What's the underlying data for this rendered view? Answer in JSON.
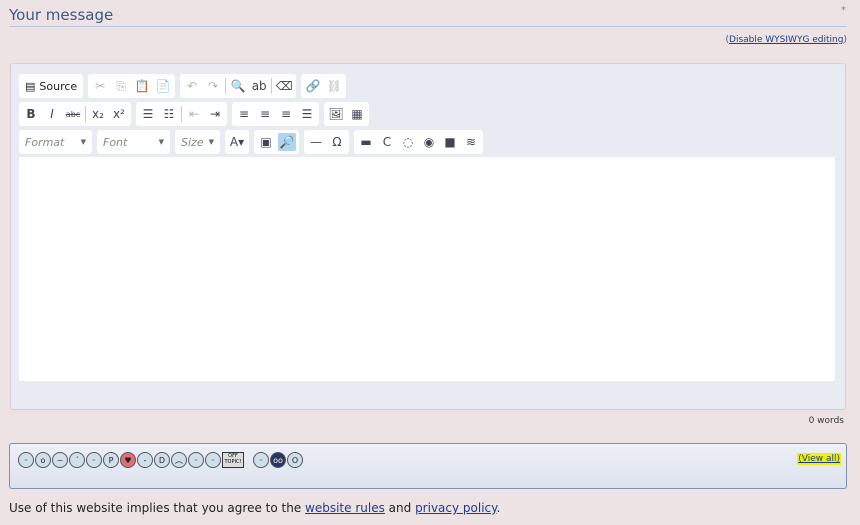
{
  "header": {
    "title": "Your message",
    "required_mark": "*",
    "disable_wysiwyg": "Disable WYSIWYG editing",
    "paren_open": "(",
    "paren_close": ")"
  },
  "toolbar": {
    "source_label": "Source",
    "row1": [
      [
        "cut-icon",
        "✂",
        true
      ],
      [
        "copy-icon",
        "⎘",
        true
      ],
      [
        "paste-icon",
        "📋",
        false
      ],
      [
        "paste-word-icon",
        "📄",
        false
      ],
      null,
      [
        "undo-icon",
        "↶",
        true
      ],
      [
        "redo-icon",
        "↷",
        true
      ],
      "|",
      [
        "find-icon",
        "🔍",
        false
      ],
      [
        "replace-icon",
        "ab",
        false
      ],
      "|",
      [
        "remove-format-icon",
        "⌫",
        false
      ],
      null,
      [
        "link-icon",
        "🔗",
        false
      ],
      [
        "unlink-icon",
        "⛓",
        true
      ]
    ],
    "row2": [
      [
        "bold-icon",
        "B",
        false
      ],
      [
        "italic-icon",
        "I",
        false
      ],
      [
        "strike-icon",
        "abc",
        false
      ],
      "|",
      [
        "subscript-icon",
        "x₂",
        false
      ],
      [
        "superscript-icon",
        "x²",
        false
      ],
      null,
      [
        "numbered-list-icon",
        "☰",
        false
      ],
      [
        "bulleted-list-icon",
        "☷",
        false
      ],
      "|",
      [
        "outdent-icon",
        "⇤",
        true
      ],
      [
        "indent-icon",
        "⇥",
        false
      ],
      null,
      [
        "align-left-icon",
        "≡",
        false
      ],
      [
        "align-center-icon",
        "≡",
        false
      ],
      [
        "align-right-icon",
        "≡",
        false
      ],
      [
        "justify-icon",
        "☰",
        false
      ],
      null,
      [
        "image-icon",
        "🖼",
        false
      ],
      [
        "table-icon",
        "▦",
        false
      ]
    ],
    "format": "Format",
    "font": "Font",
    "size": "Size",
    "row3": [
      [
        "text-color-icon",
        "A▾",
        false
      ],
      null,
      [
        "maximize-icon",
        "▣",
        false
      ],
      [
        "show-blocks-icon",
        "🔎",
        false
      ],
      null,
      [
        "horizontal-rule-icon",
        "—",
        false
      ],
      [
        "special-char-icon",
        "Ω",
        false
      ],
      null,
      [
        "quote-icon",
        "▬",
        false
      ],
      [
        "code-icon",
        "C",
        false
      ],
      [
        "spoiler-icon",
        "◌",
        false
      ],
      [
        "emoticon-icon",
        "◉",
        false
      ],
      [
        "highlight-icon",
        "■",
        false
      ],
      [
        "text-icon",
        "≋",
        false
      ]
    ]
  },
  "word_count": "0 words",
  "smileys": {
    "view_all": "(View all)",
    "sign_text": "OFF TOPIC!"
  },
  "footer": {
    "prefix": "Use of this website implies that you agree to the ",
    "rules": "website rules",
    "and": " and ",
    "privacy": "privacy policy",
    "suffix": "."
  }
}
